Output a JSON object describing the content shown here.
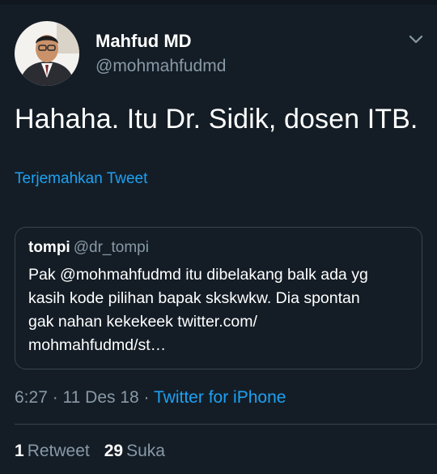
{
  "author": {
    "name": "Mahfud MD",
    "handle": "@mohmahfudmd",
    "avatar_icon": "person-avatar"
  },
  "tweet": {
    "text": "Hahaha. Itu Dr. Sidik, dosen ITB.",
    "translate_label": "Terjemahkan Tweet"
  },
  "quoted": {
    "name": "tompi",
    "handle": "@dr_tompi",
    "text": "Pak @mohmahfudmd  itu dibelakang balk ada yg\nkasih kode pilihan bapak skskwkw.  Dia spontan\ngak nahan kekekeek twitter.com/\nmohmahfudmd/st…"
  },
  "meta": {
    "time": "6:27 · 11 Des 18",
    "separator": " · ",
    "source": "Twitter for iPhone"
  },
  "stats": {
    "retweets_count": "1",
    "retweets_label": "Retweet",
    "likes_count": "29",
    "likes_label": "Suka"
  },
  "colors": {
    "background": "#141d26",
    "accent": "#1da1f2",
    "muted": "#8899a6",
    "border": "#38444d"
  }
}
